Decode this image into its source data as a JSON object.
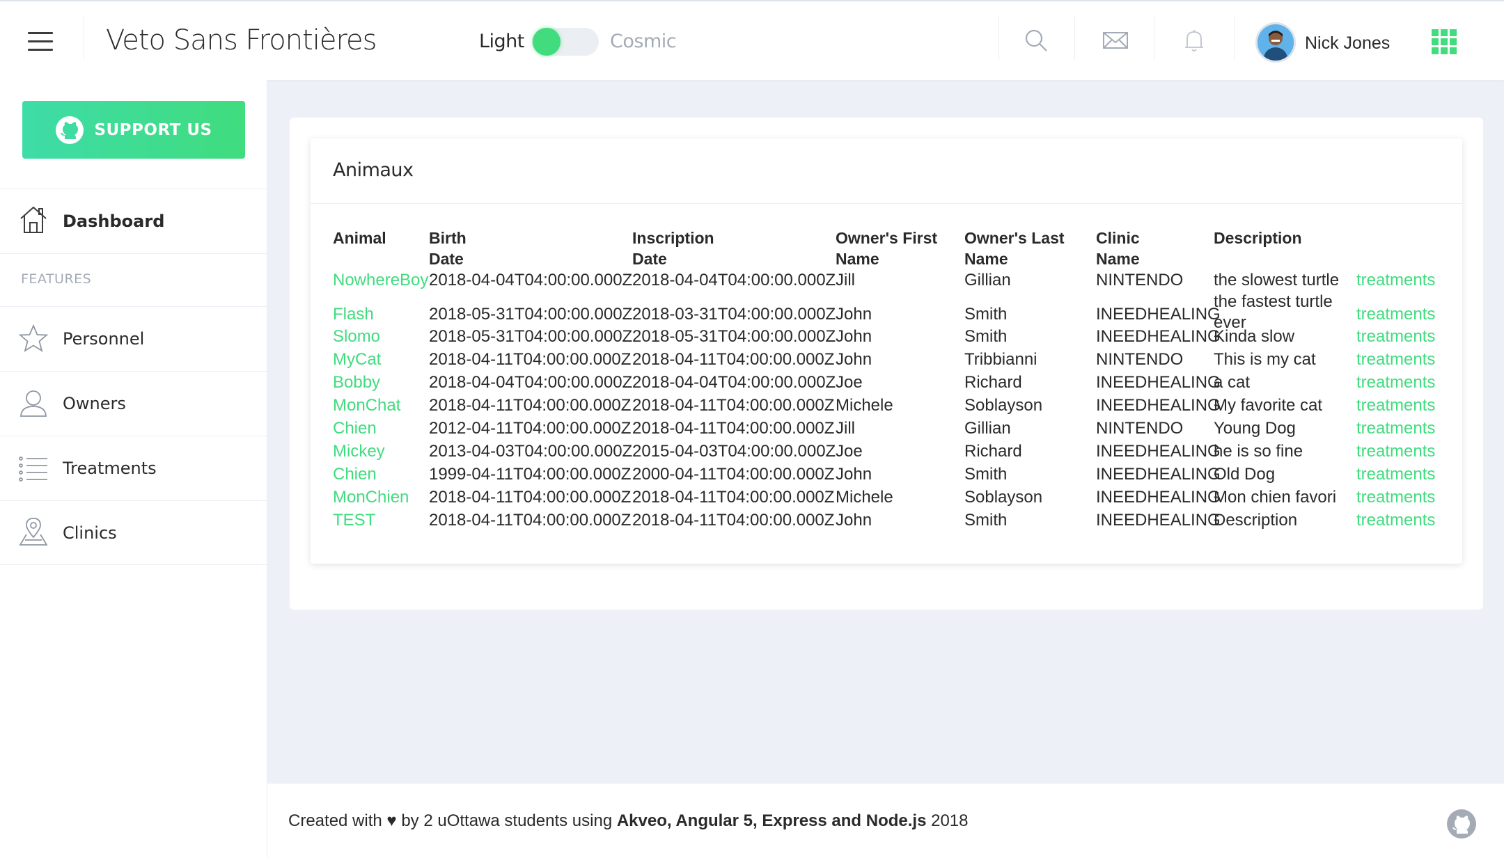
{
  "header": {
    "app_title": "Veto Sans Frontières",
    "theme_light_label": "Light",
    "theme_dark_label": "Cosmic",
    "user_name": "Nick Jones",
    "accent_color": "#40dc7e"
  },
  "sidebar": {
    "support_label": "SUPPORT US",
    "dashboard_label": "Dashboard",
    "features_heading": "FEATURES",
    "items": [
      {
        "label": "Personnel",
        "icon": "star-icon"
      },
      {
        "label": "Owners",
        "icon": "person-icon"
      },
      {
        "label": "Treatments",
        "icon": "list-icon"
      },
      {
        "label": "Clinics",
        "icon": "map-pin-icon"
      }
    ]
  },
  "card": {
    "title": "Animaux",
    "columns": [
      "Animal",
      "Birth Date",
      "Inscription Date",
      "Owner's First Name",
      "Owner's Last Name",
      "Clinic Name",
      "Description"
    ],
    "rows": [
      {
        "animal": "NowhereBoy",
        "birth": "2018-04-04T04:00:00.000Z",
        "inscription": "2018-04-04T04:00:00.000Z",
        "first": "Jill",
        "last": "Gillian",
        "clinic": "NINTENDO",
        "description": "the slowest turtle",
        "action": "treatments"
      },
      {
        "animal": "Flash",
        "birth": "2018-05-31T04:00:00.000Z",
        "inscription": "2018-03-31T04:00:00.000Z",
        "first": "John",
        "last": "Smith",
        "clinic": "INEEDHEALING",
        "description": "the fastest turtle ever",
        "action": "treatments"
      },
      {
        "animal": "Slomo",
        "birth": "2018-05-31T04:00:00.000Z",
        "inscription": "2018-05-31T04:00:00.000Z",
        "first": "John",
        "last": "Smith",
        "clinic": "INEEDHEALING",
        "description": "Kinda slow",
        "action": "treatments"
      },
      {
        "animal": "MyCat",
        "birth": "2018-04-11T04:00:00.000Z",
        "inscription": "2018-04-11T04:00:00.000Z",
        "first": "John",
        "last": "Tribbianni",
        "clinic": "NINTENDO",
        "description": "This is my cat",
        "action": "treatments"
      },
      {
        "animal": "Bobby",
        "birth": "2018-04-04T04:00:00.000Z",
        "inscription": "2018-04-04T04:00:00.000Z",
        "first": "Joe",
        "last": "Richard",
        "clinic": "INEEDHEALING",
        "description": "a cat",
        "action": "treatments"
      },
      {
        "animal": "MonChat",
        "birth": "2018-04-11T04:00:00.000Z",
        "inscription": "2018-04-11T04:00:00.000Z",
        "first": "Michele",
        "last": "Soblayson",
        "clinic": "INEEDHEALING",
        "description": "My favorite cat",
        "action": "treatments"
      },
      {
        "animal": "Chien",
        "birth": "2012-04-11T04:00:00.000Z",
        "inscription": "2018-04-11T04:00:00.000Z",
        "first": "Jill",
        "last": "Gillian",
        "clinic": "NINTENDO",
        "description": "Young Dog",
        "action": "treatments"
      },
      {
        "animal": "Mickey",
        "birth": "2013-04-03T04:00:00.000Z",
        "inscription": "2015-04-03T04:00:00.000Z",
        "first": "Joe",
        "last": "Richard",
        "clinic": "INEEDHEALING",
        "description": "he is so fine",
        "action": "treatments"
      },
      {
        "animal": "Chien",
        "birth": "1999-04-11T04:00:00.000Z",
        "inscription": "2000-04-11T04:00:00.000Z",
        "first": "John",
        "last": "Smith",
        "clinic": "INEEDHEALING",
        "description": "Old Dog",
        "action": "treatments"
      },
      {
        "animal": "MonChien",
        "birth": "2018-04-11T04:00:00.000Z",
        "inscription": "2018-04-11T04:00:00.000Z",
        "first": "Michele",
        "last": "Soblayson",
        "clinic": "INEEDHEALING",
        "description": "Mon chien favori",
        "action": "treatments"
      },
      {
        "animal": "TEST",
        "birth": "2018-04-11T04:00:00.000Z",
        "inscription": "2018-04-11T04:00:00.000Z",
        "first": "John",
        "last": "Smith",
        "clinic": "INEEDHEALING",
        "description": "Description",
        "action": "treatments"
      }
    ]
  },
  "footer": {
    "prefix": "Created with ♥ by 2 uOttawa students using ",
    "tech": "Akveo, Angular 5, Express and Node.js",
    "year": " 2018"
  }
}
